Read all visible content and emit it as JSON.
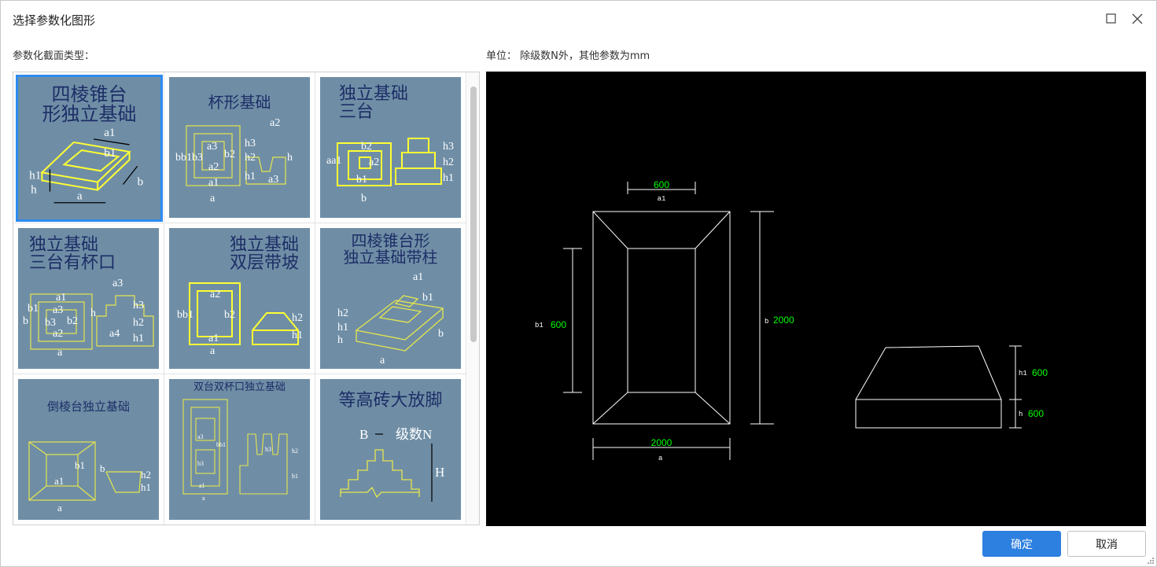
{
  "window": {
    "title": "选择参数化图形",
    "maximize_icon": "square-icon",
    "close_icon": "x-icon"
  },
  "labels": {
    "section_type": "参数化截面类型：",
    "unit_note": "单位： 除级数N外，其他参数为mm"
  },
  "gallery": {
    "items": [
      {
        "title": "四棱锥台\n形独立基础",
        "selected": true,
        "labels": [
          "a1",
          "b1",
          "h1",
          "h",
          "a",
          "b"
        ]
      },
      {
        "title": "杯形基础",
        "selected": false,
        "labels": [
          "a2",
          "h3",
          "a3",
          "b2",
          "h2",
          "bb1b3",
          "a2",
          "h",
          "a1",
          "h1",
          "a3",
          "a"
        ]
      },
      {
        "title": "独立基础\n三台",
        "selected": false,
        "labels": [
          "b2",
          "aa1",
          "a2",
          "h3",
          "h2",
          "b1",
          "h1",
          "b"
        ]
      },
      {
        "title": "独立基础\n三台有杯口",
        "selected": false,
        "labels": [
          "a3",
          "a1",
          "b1",
          "a3",
          "b",
          "b3",
          "b2",
          "h",
          "h3",
          "h2",
          "a2",
          "a4",
          "h1",
          "a"
        ]
      },
      {
        "title": "独立基础\n双层带坡",
        "selected": false,
        "labels": [
          "a2",
          "bb1",
          "b2",
          "h2",
          "a1",
          "h1",
          "a"
        ]
      },
      {
        "title": "四棱锥台形\n独立基础带柱",
        "selected": false,
        "labels": [
          "a1",
          "b1",
          "h2",
          "h1",
          "h",
          "b",
          "a"
        ]
      },
      {
        "title": "倒棱台独立基础",
        "selected": false,
        "labels": [
          "b1",
          "b",
          "h2",
          "a1",
          "h1",
          "a"
        ]
      },
      {
        "title": "双台双杯口独立基础",
        "selected": false,
        "labels": [
          "a3",
          "h3",
          "b3",
          "a1",
          "h2",
          "h1",
          "a",
          "bb1"
        ]
      },
      {
        "title": "等高砖大放脚",
        "selected": false,
        "labels": [
          "B",
          "级数N",
          "H"
        ]
      }
    ]
  },
  "preview": {
    "accent_value_color": "#00ff00",
    "line_color": "#ffffff",
    "dims": {
      "a1_value": "600",
      "a1_name": "a1",
      "b1_name": "b1",
      "b1_value": "600",
      "b_name": "b",
      "b_value": "2000",
      "a_value": "2000",
      "a_name": "a",
      "h1_name": "h1",
      "h1_value": "600",
      "h_name": "h",
      "h_value": "600"
    }
  },
  "buttons": {
    "ok": "确定",
    "cancel": "取消"
  }
}
